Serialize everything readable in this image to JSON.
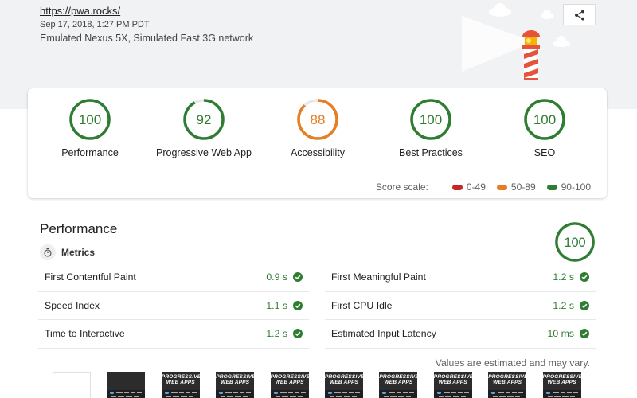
{
  "header": {
    "url": "https://pwa.rocks/",
    "timestamp": "Sep 17, 2018, 1:27 PM PDT",
    "environment": "Emulated Nexus 5X, Simulated Fast 3G network",
    "share_icon": "share-icon"
  },
  "colors": {
    "pass": "#2e7d32",
    "average": "#e67e22",
    "fail": "#c62828",
    "track": "#e8e8e8"
  },
  "scores": [
    {
      "label": "Performance",
      "score": 100,
      "rating": "pass"
    },
    {
      "label": "Progressive Web App",
      "score": 92,
      "rating": "pass"
    },
    {
      "label": "Accessibility",
      "score": 88,
      "rating": "average"
    },
    {
      "label": "Best Practices",
      "score": 100,
      "rating": "pass"
    },
    {
      "label": "SEO",
      "score": 100,
      "rating": "pass"
    }
  ],
  "score_scale": {
    "label": "Score scale:",
    "ranges": [
      {
        "label": "0-49",
        "rating": "fail"
      },
      {
        "label": "50-89",
        "rating": "average"
      },
      {
        "label": "90-100",
        "rating": "pass"
      }
    ]
  },
  "performance": {
    "title": "Performance",
    "score": 100,
    "metrics_label": "Metrics",
    "metrics_icon": "stopwatch-icon",
    "metrics_left": [
      {
        "name": "First Contentful Paint",
        "value": "0.9 s"
      },
      {
        "name": "Speed Index",
        "value": "1.1 s"
      },
      {
        "name": "Time to Interactive",
        "value": "1.2 s"
      }
    ],
    "metrics_right": [
      {
        "name": "First Meaningful Paint",
        "value": "1.2 s"
      },
      {
        "name": "First CPU Idle",
        "value": "1.2 s"
      },
      {
        "name": "Estimated Input Latency",
        "value": "10 ms"
      }
    ],
    "note": "Values are estimated and may vary.",
    "filmstrip": {
      "frame_title": "Progressive Web Apps",
      "frames": [
        "blank",
        "dark",
        "title",
        "title",
        "title",
        "title",
        "title",
        "title",
        "title",
        "title"
      ]
    }
  }
}
